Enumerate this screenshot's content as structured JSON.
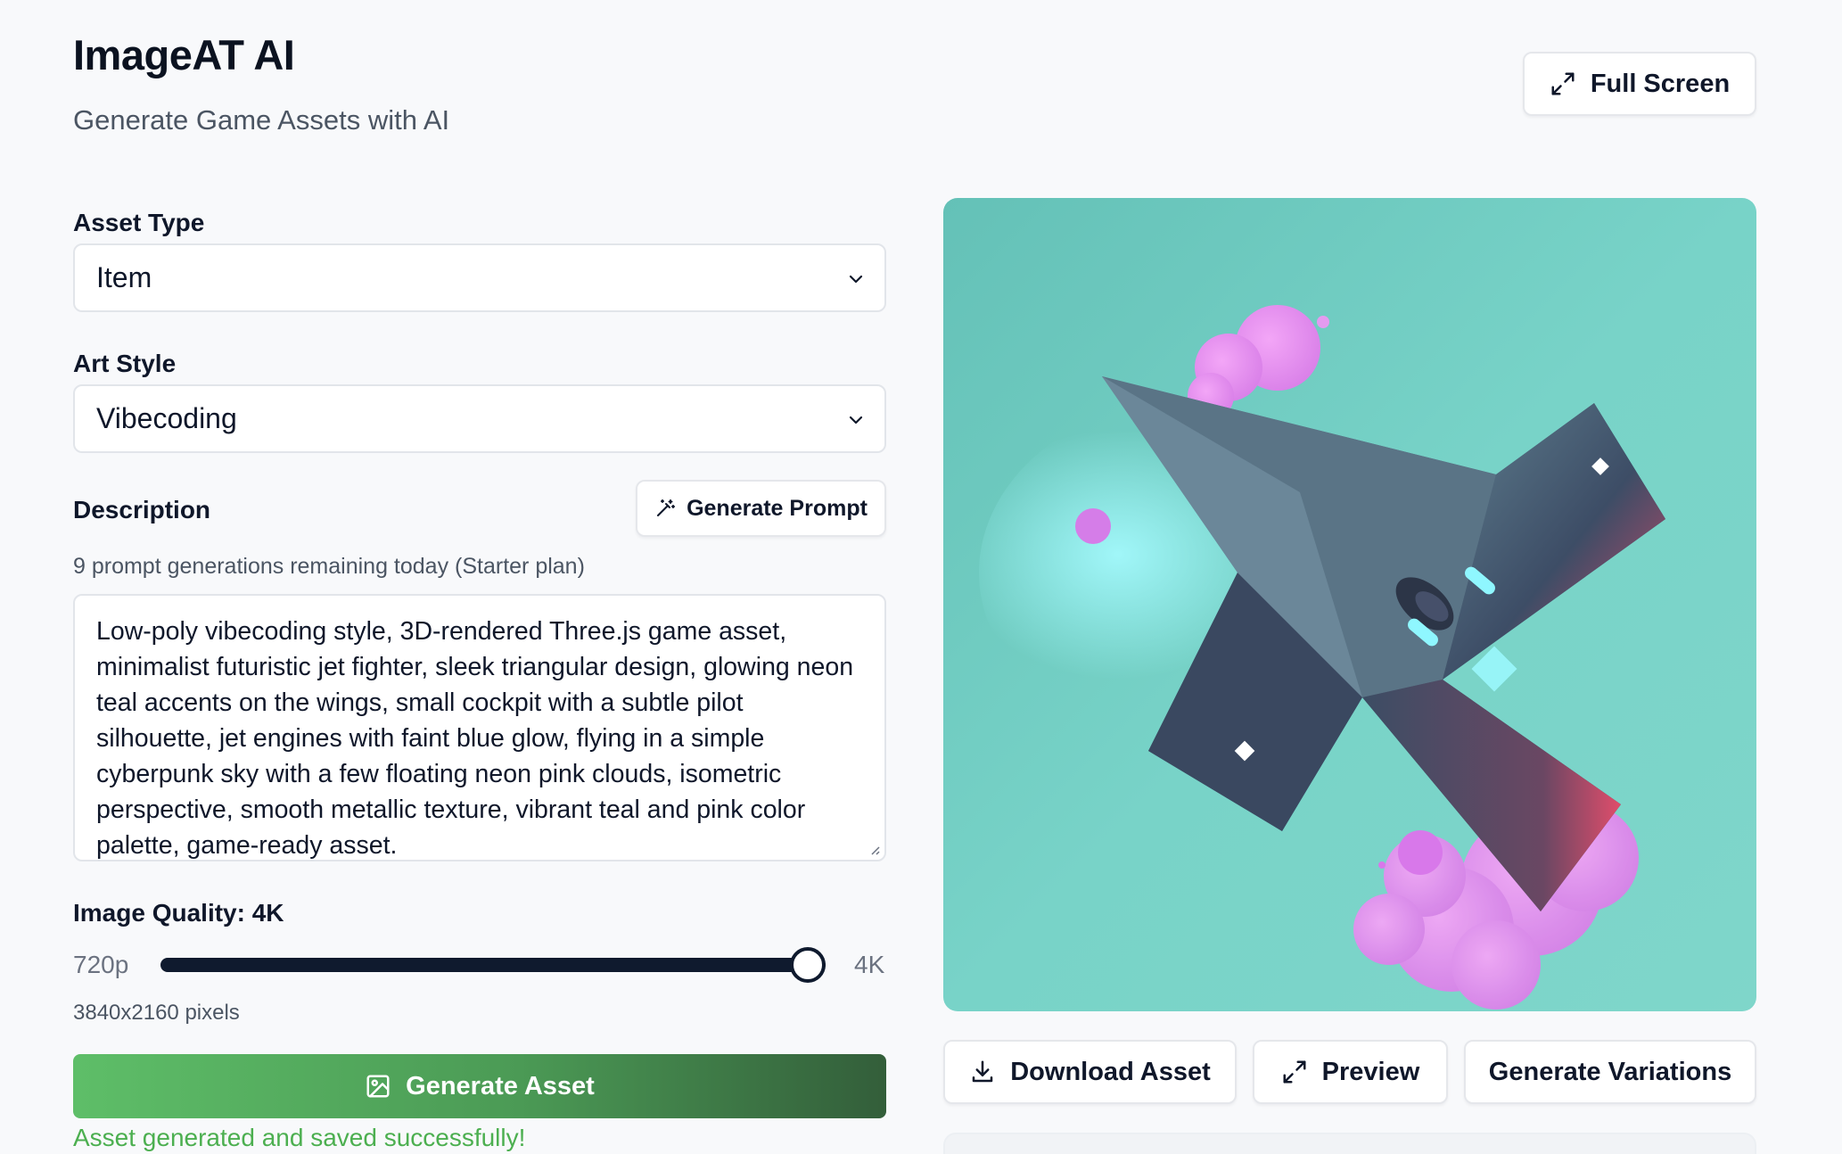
{
  "header": {
    "title": "ImageAT AI",
    "subtitle": "Generate Game Assets with AI",
    "fullscreen_label": "Full Screen"
  },
  "form": {
    "asset_type": {
      "label": "Asset Type",
      "value": "Item"
    },
    "art_style": {
      "label": "Art Style",
      "value": "Vibecoding"
    },
    "description": {
      "label": "Description",
      "generate_prompt_label": "Generate Prompt",
      "remaining_text": "9 prompt generations remaining today (Starter plan)",
      "value": "Low-poly vibecoding style, 3D-rendered Three.js game asset, minimalist futuristic jet fighter, sleek triangular design, glowing neon teal accents on the wings, small cockpit with a subtle pilot silhouette, jet engines with faint blue glow, flying in a simple cyberpunk sky with a few floating neon pink clouds, isometric perspective, smooth metallic texture, vibrant teal and pink color palette, game-ready asset."
    },
    "quality": {
      "label": "Image Quality: 4K",
      "min_label": "720p",
      "max_label": "4K",
      "value_fraction": 1.0,
      "pixels_text": "3840x2160 pixels"
    },
    "generate_label": "Generate Asset",
    "status_text": "Asset generated and saved successfully!"
  },
  "preview": {
    "image_alt": "Low-poly jet fighter asset over teal sky with pink clouds",
    "actions": {
      "download_label": "Download Asset",
      "preview_label": "Preview",
      "variations_label": "Generate Variations"
    }
  },
  "colors": {
    "accent_green": "#5ebe68",
    "success_text": "#4caf50",
    "slider": "#0f1a2e",
    "teal_bg": "#6fcfc4",
    "cloud_pink": "#e89cf0"
  }
}
